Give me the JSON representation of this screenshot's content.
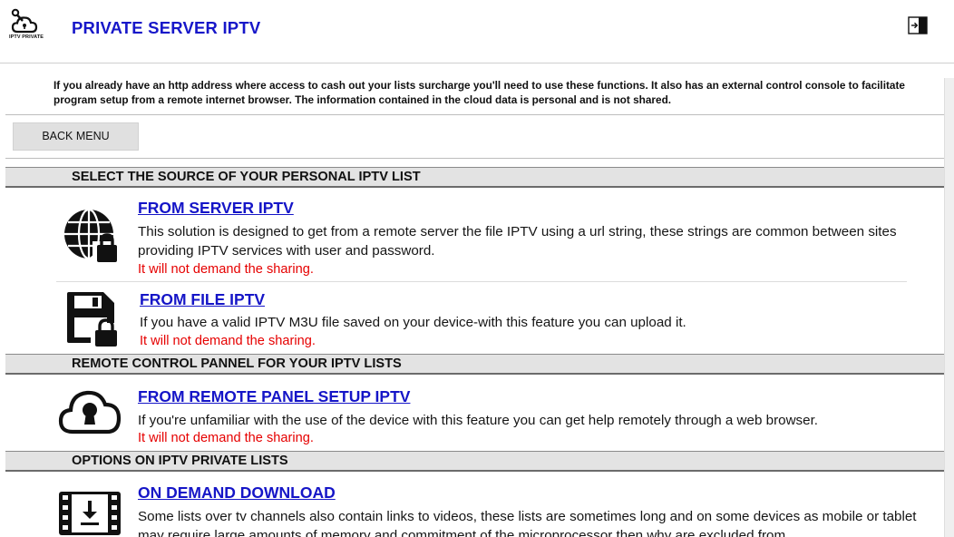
{
  "app": {
    "title": "PRIVATE SERVER IPTV",
    "logo_text": "IPTV PRIVATE",
    "logo_icon": "cloud-key-icon",
    "exit_icon": "exit-to-app-icon"
  },
  "intro": {
    "text": "If you already have an http address where access to cash out your lists surcharge you'll need to use these functions. It also has an external control console to facilitate program setup from a remote internet browser. The information contained in the cloud data is personal and is not shared."
  },
  "back_button": {
    "label": "BACK MENU"
  },
  "sections": {
    "source": {
      "title": "SELECT THE SOURCE OF YOUR PERSONAL IPTV LIST"
    },
    "remote": {
      "title": "REMOTE CONTROL PANNEL FOR YOUR IPTV LISTS"
    },
    "options": {
      "title": "OPTIONS ON IPTV PRIVATE LISTS"
    }
  },
  "items": {
    "server": {
      "title": "FROM SERVER IPTV",
      "description": "This solution is designed to get from a remote server the file IPTV using a url string, these strings are common between sites providing IPTV services with user and password.",
      "warning": "It will not demand the sharing.",
      "icon": "globe-lock-icon"
    },
    "file": {
      "title": "FROM FILE IPTV",
      "description": "If you have a valid IPTV M3U file saved on your device-with this feature you can upload it.",
      "warning": "It will not demand the sharing.",
      "icon": "floppy-lock-icon"
    },
    "remote_panel": {
      "title": "FROM REMOTE PANEL SETUP IPTV",
      "description": "If you're unfamiliar with the use of the device with this feature you can get help remotely through a web browser.",
      "warning": "It will not demand the sharing.",
      "icon": "cloud-keyhole-icon"
    },
    "download": {
      "title": "ON DEMAND DOWNLOAD",
      "description": "Some lists over tv channels also contain links to videos, these lists are sometimes long and on some devices as mobile or tablet may require large amounts of memory and commitment of the microprocessor then why are excluded from",
      "icon": "film-download-icon"
    }
  },
  "colors": {
    "title_blue": "#1717c9",
    "link_blue": "#1515c7",
    "warning_red": "#e60000",
    "section_bg": "#e3e3e3",
    "button_bg": "#e0e0e0"
  }
}
